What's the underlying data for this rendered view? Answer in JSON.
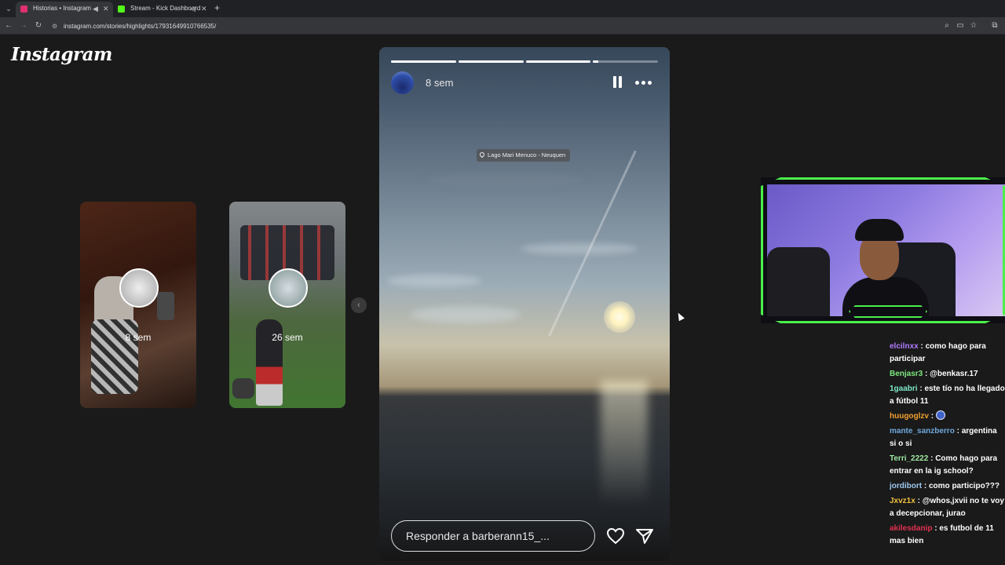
{
  "browser": {
    "tabs": [
      {
        "title": "Historias • Instagram",
        "favicon_color": "#e1306c",
        "active": true
      },
      {
        "title": "Stream - Kick Dashboard",
        "favicon_color": "#53fc18",
        "active": false
      }
    ],
    "url": "instagram.com/stories/highlights/17931649910766535/"
  },
  "instagram": {
    "logo": "Instagram",
    "previous_stories": [
      {
        "time": "8 sem"
      },
      {
        "time": "26 sem"
      }
    ],
    "story": {
      "time": "8 sem",
      "location": "Lago Mari Menuco - Neuquen",
      "reply_placeholder": "Responder a barberann15_...",
      "progress": [
        1,
        1,
        1,
        0.08
      ]
    }
  },
  "stream": {
    "chat": [
      {
        "user": "elcilnxx",
        "color": "#b27bff",
        "text": "como hago para participar"
      },
      {
        "user": "Benjasr3",
        "color": "#7ee87e",
        "text": "@benkasr.17"
      },
      {
        "user": "1gaabri",
        "color": "#7ee8c8",
        "text": "este tío no ha llegado a fútbol 11"
      },
      {
        "user": "huugoglzv",
        "color": "#f0a030",
        "text": "",
        "emoji": "emote-icon"
      },
      {
        "user": "mante_sanzberro",
        "color": "#6fa8dc",
        "text": "argentina si o si"
      },
      {
        "user": "Terri_2222",
        "color": "#9fe8a0",
        "text": "Como hago para entrar en la ig school?"
      },
      {
        "user": "jordibort",
        "color": "#9ec8f0",
        "text": "como participo???"
      },
      {
        "user": "Jxvz1x",
        "color": "#f0c040",
        "text": "@whos,jxvii no te voy a decepcionar, jurao"
      },
      {
        "user": "akilesdanip",
        "color": "#e03050",
        "text": "es futbol de 11 mas bien"
      }
    ]
  }
}
